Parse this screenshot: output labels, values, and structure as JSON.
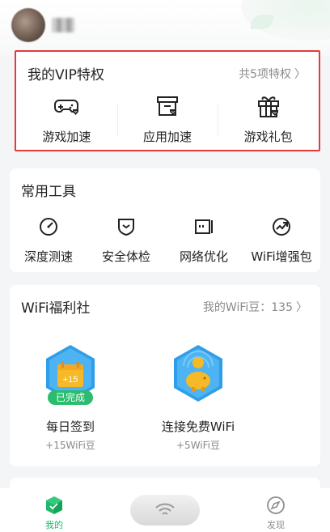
{
  "vip": {
    "title": "我的VIP特权",
    "summary": "共5项特权",
    "items": [
      {
        "label": "游戏加速",
        "icon": "gamepad-icon"
      },
      {
        "label": "应用加速",
        "icon": "app-box-icon"
      },
      {
        "label": "游戏礼包",
        "icon": "gift-icon"
      }
    ]
  },
  "tools": {
    "title": "常用工具",
    "items": [
      {
        "label": "深度测速",
        "icon": "speedometer-icon"
      },
      {
        "label": "安全体检",
        "icon": "shield-icon"
      },
      {
        "label": "网络优化",
        "icon": "network-optimize-icon"
      },
      {
        "label": "WiFi增强包",
        "icon": "boost-chart-icon"
      }
    ]
  },
  "welfare": {
    "title": "WiFi福利社",
    "beans_label": "我的WiFi豆：135",
    "tasks": [
      {
        "title": "每日签到",
        "reward": "+15WiFi豆",
        "badge": "已完成",
        "calendar_text": "+15",
        "icon": "calendar-checkin-icon"
      },
      {
        "title": "连接免费WiFi",
        "reward": "+5WiFi豆",
        "icon": "piggy-bank-icon"
      }
    ]
  },
  "tabbar": {
    "mine": "我的",
    "discover": "发现",
    "accent": "#1fb96a"
  }
}
